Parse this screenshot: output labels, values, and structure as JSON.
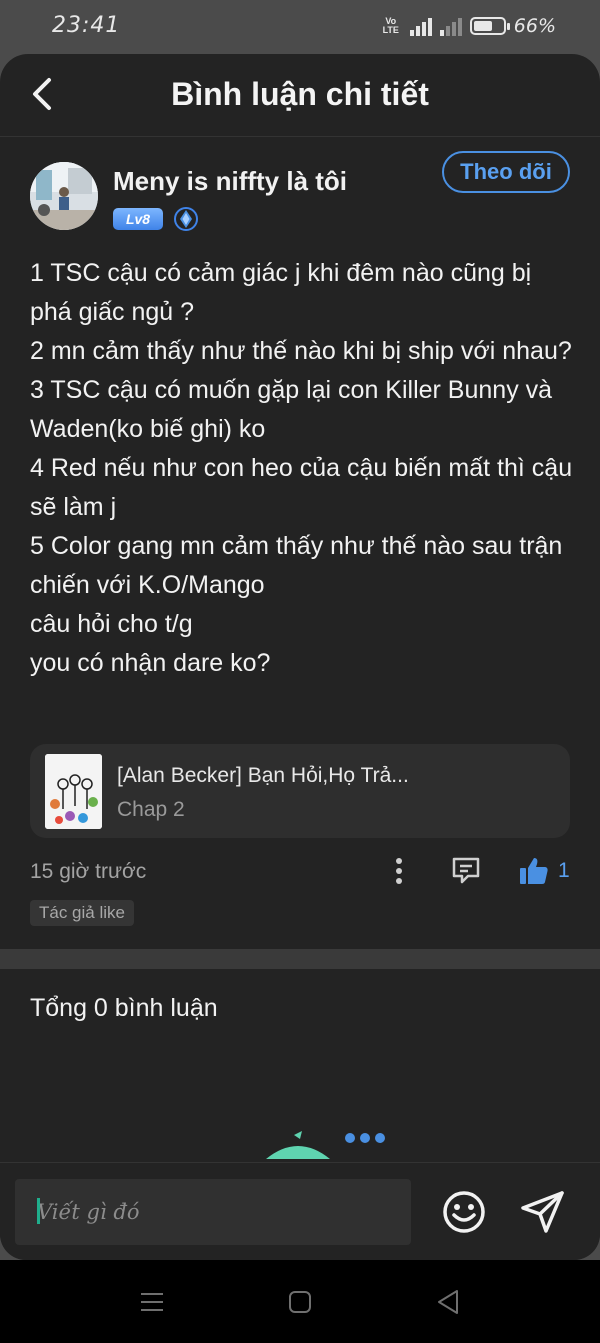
{
  "status_bar": {
    "time": "23:41",
    "volte_label": "Vo LTE",
    "battery_percent": "66%",
    "battery_level": 0.66
  },
  "header": {
    "title": "Bình luận chi tiết",
    "back_icon": "chevron-left-icon"
  },
  "comment": {
    "author_name": "Meny is niffty là tôi",
    "level_badge": "Lv8",
    "follow_label": "Theo dõi",
    "lines": [
      "1 TSC cậu có cảm giác j khi đêm nào cũng bị phá giấc ngủ ?",
      "2 mn cảm thấy như thế nào khi bị ship với nhau?",
      "3 TSC cậu có muốn gặp lại con Killer Bunny và Waden(ko biế ghi) ko",
      "4 Red nếu như con heo của cậu biến mất thì cậu sẽ làm j",
      "5 Color gang mn cảm thấy như thế nào sau trận chiến với K.O/Mango",
      "câu hỏi cho t/g",
      "you có nhận dare ko?"
    ],
    "story": {
      "title": "[Alan Becker] Bạn Hỏi,Họ Trả...",
      "chapter": "Chap 2"
    },
    "time_ago": "15 giờ trước",
    "like_count": "1",
    "author_like_tag": "Tác giả like"
  },
  "comments_section": {
    "total_label": "Tổng 0 bình luận"
  },
  "input_bar": {
    "placeholder": "Viết gì đó"
  },
  "colors": {
    "accent": "#4a90e2",
    "background": "#232323",
    "caret": "#1fae8c"
  },
  "icons": {
    "more": "more-vertical-icon",
    "reply": "comment-icon",
    "like": "thumbs-up-icon",
    "emoji": "smiley-icon",
    "send": "send-icon"
  }
}
